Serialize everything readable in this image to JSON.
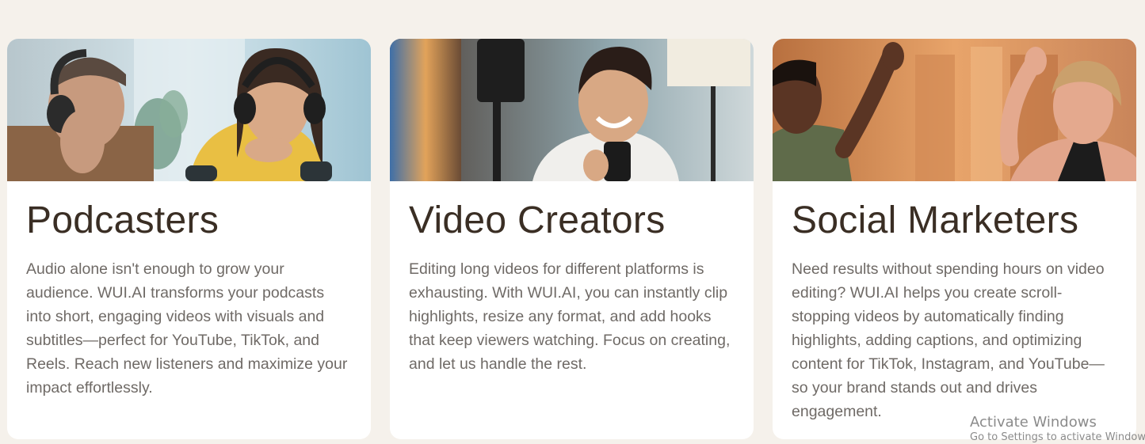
{
  "cards": [
    {
      "title": "Podcasters",
      "description": "Audio alone isn't enough to grow your audience. WUI.AI transforms your podcasts into short, engaging videos with visuals and subtitles—perfect for YouTube, TikTok, and Reels. Reach new listeners and maximize your impact effortlessly."
    },
    {
      "title": "Video Creators",
      "description": "Editing long videos for different platforms is exhausting. With WUI.AI, you can instantly clip highlights, resize any format, and add hooks that keep viewers watching. Focus on creating, and let us handle the rest."
    },
    {
      "title": "Social Marketers",
      "description": "Need results without spending hours on video editing? WUI.AI helps you create scroll-stopping videos by automatically finding highlights, adding captions, and optimizing content for TikTok, Instagram, and YouTube—so your brand stands out and drives engagement."
    }
  ],
  "watermark": {
    "line1": "Activate Windows",
    "line2": "Go to Settings to activate Windows."
  },
  "colors": {
    "page_background": "#f5f1eb",
    "card_background": "#ffffff",
    "title_color": "#3a2e24",
    "body_color": "#6f6a66"
  }
}
